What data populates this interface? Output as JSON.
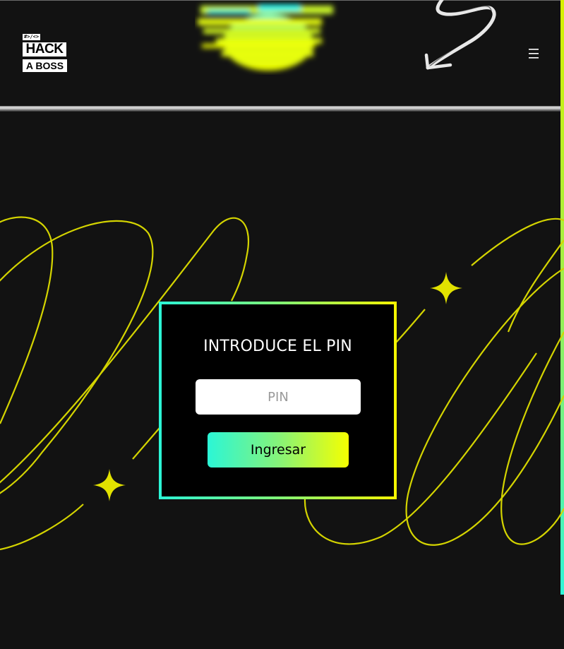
{
  "header": {
    "logo": {
      "code_tag": "#>/<>",
      "line1": "HACK",
      "line2": "A BOSS"
    },
    "menu_icon": "hamburger-menu-icon"
  },
  "pin_form": {
    "title": "INTRODUCE EL PIN",
    "input_placeholder": "PIN",
    "input_value": "",
    "submit_label": "Ingresar"
  },
  "colors": {
    "background": "#121212",
    "accent_cyan": "#2bf6d6",
    "accent_yellow": "#f6f600",
    "line_yellow": "#d4d400"
  }
}
